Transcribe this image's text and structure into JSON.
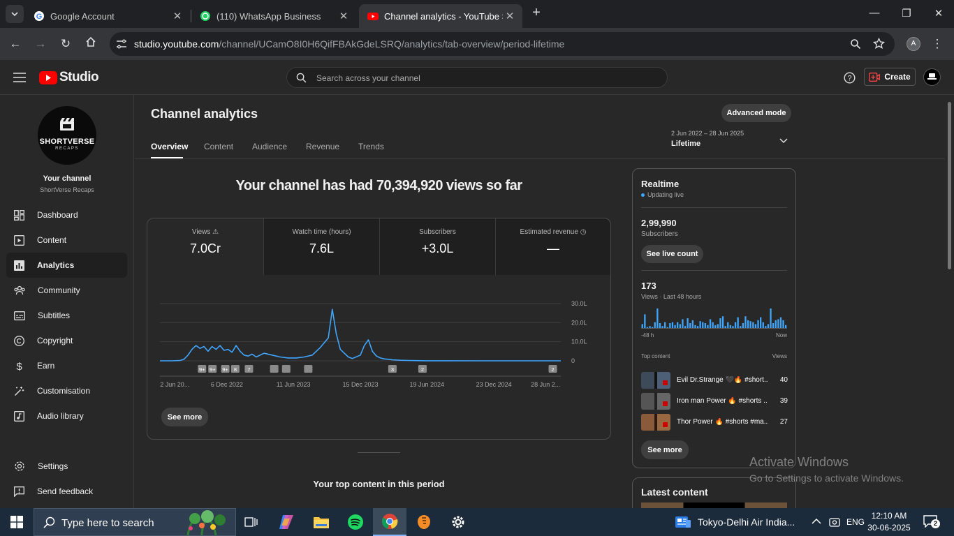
{
  "browser": {
    "tabs": [
      {
        "title": "Google Account",
        "active": false
      },
      {
        "title": "(110) WhatsApp Business",
        "active": false
      },
      {
        "title": "Channel analytics - YouTube Stu",
        "active": true
      }
    ],
    "url_host": "studio.youtube.com",
    "url_path": "/channel/UCamO8I0H6QifFBAkGdeLSRQ/analytics/tab-overview/period-lifetime",
    "profile_initial": "A"
  },
  "header": {
    "logo_text": "Studio",
    "search_placeholder": "Search across your channel",
    "create_label": "Create"
  },
  "sidebar": {
    "avatar_text": "SHORTVERSE",
    "avatar_subtext": "RECAPS",
    "your_channel": "Your channel",
    "channel_name": "ShortVerse Recaps",
    "items": [
      {
        "label": "Dashboard",
        "icon": "dashboard-icon"
      },
      {
        "label": "Content",
        "icon": "content-icon"
      },
      {
        "label": "Analytics",
        "icon": "analytics-icon",
        "selected": true
      },
      {
        "label": "Community",
        "icon": "community-icon"
      },
      {
        "label": "Subtitles",
        "icon": "subtitles-icon"
      },
      {
        "label": "Copyright",
        "icon": "copyright-icon"
      },
      {
        "label": "Earn",
        "icon": "earn-icon"
      },
      {
        "label": "Customisation",
        "icon": "customisation-icon"
      },
      {
        "label": "Audio library",
        "icon": "audio-library-icon"
      }
    ],
    "bottom_items": [
      {
        "label": "Settings",
        "icon": "settings-icon"
      },
      {
        "label": "Send feedback",
        "icon": "feedback-icon"
      }
    ]
  },
  "main": {
    "title": "Channel analytics",
    "advanced_mode": "Advanced mode",
    "date_range": "2 Jun 2022 – 28 Jun 2025",
    "period": "Lifetime",
    "tabs": [
      "Overview",
      "Content",
      "Audience",
      "Revenue",
      "Trends"
    ],
    "headline": "Your channel has had 70,394,920 views so far",
    "metrics": [
      {
        "label": "Views",
        "value": "7.0Cr"
      },
      {
        "label": "Watch time (hours)",
        "value": "7.6L"
      },
      {
        "label": "Subscribers",
        "value": "+3.0L"
      },
      {
        "label": "Estimated revenue",
        "value": "—"
      }
    ],
    "see_more": "See more",
    "top_content_title": "Your top content in this period"
  },
  "chart_data": {
    "type": "line",
    "x_labels": [
      "2 Jun 20...",
      "6 Dec 2022",
      "11 Jun 2023",
      "15 Dec 2023",
      "19 Jun 2024",
      "23 Dec 2024",
      "28 Jun 2..."
    ],
    "y_ticks": [
      "30.0L",
      "20.0L",
      "10.0L",
      "0"
    ],
    "ylim": [
      0,
      30
    ],
    "y_unit": "L",
    "grid": true,
    "series": [
      {
        "color": "#3ea6ff",
        "x": [
          0,
          3,
          5,
          6,
          7,
          8,
          9,
          10,
          11,
          12,
          13,
          14,
          15,
          16,
          17,
          18,
          19,
          20,
          21,
          22,
          23,
          24,
          26,
          28,
          30,
          32,
          34,
          36,
          38,
          40,
          42,
          43,
          44,
          45,
          46,
          47,
          48,
          50,
          51,
          52,
          53,
          54,
          55,
          56,
          57,
          58,
          60,
          62,
          64,
          66,
          70,
          80,
          100
        ],
        "values": [
          0,
          0,
          0.2,
          0.8,
          3,
          6,
          8,
          6.5,
          7.5,
          5,
          7.5,
          6,
          8,
          5.5,
          6,
          4.5,
          8,
          5,
          3,
          2.5,
          3.5,
          2,
          4,
          3,
          2,
          1.5,
          1.5,
          2,
          3,
          7,
          12,
          27,
          14,
          6,
          4,
          2,
          1.2,
          3,
          8,
          11,
          5,
          2.5,
          1.5,
          1,
          0.8,
          0.5,
          0.3,
          0.2,
          0.1,
          0.05,
          0.02,
          0.01,
          0.01
        ]
      }
    ],
    "markers": [
      "9+",
      "9+",
      "9+",
      "8",
      "7",
      "",
      "",
      "",
      "3",
      "2",
      "2"
    ]
  },
  "realtime": {
    "title": "Realtime",
    "status": "Updating live",
    "subscribers": "2,99,990",
    "subscribers_label": "Subscribers",
    "see_live_count": "See live count",
    "views": "173",
    "views_label": "Views · Last 48 hours",
    "axis_left": "-48 h",
    "axis_right": "Now",
    "bars": [
      4,
      14,
      1,
      2,
      1,
      6,
      20,
      5,
      2,
      6,
      1,
      5,
      6,
      3,
      6,
      4,
      9,
      2,
      10,
      5,
      8,
      3,
      2,
      7,
      6,
      5,
      3,
      9,
      6,
      3,
      4,
      10,
      12,
      2,
      6,
      3,
      2,
      6,
      11,
      2,
      5,
      12,
      8,
      7,
      6,
      4,
      8,
      11,
      6,
      2,
      4,
      20,
      5,
      8,
      9,
      11,
      8,
      3
    ],
    "top_content_label": "Top content",
    "views_col": "Views",
    "top_content": [
      {
        "title": "Evil Dr.Strange 🖤🔥 #short...",
        "views": "40"
      },
      {
        "title": "Iron man Power 🔥 #shorts ...",
        "views": "39"
      },
      {
        "title": "Thor Power 🔥 #shorts #ma...",
        "views": "27"
      }
    ],
    "see_more": "See more",
    "latest_content": "Latest content"
  },
  "watermark": {
    "line1": "Activate Windows",
    "line2": "Go to Settings to activate Windows."
  },
  "taskbar": {
    "search_placeholder": "Type here to search",
    "weather": "Tokyo-Delhi Air India...",
    "lang": "ENG",
    "time": "12:10 AM",
    "date": "30-06-2025",
    "notif_count": "2"
  }
}
